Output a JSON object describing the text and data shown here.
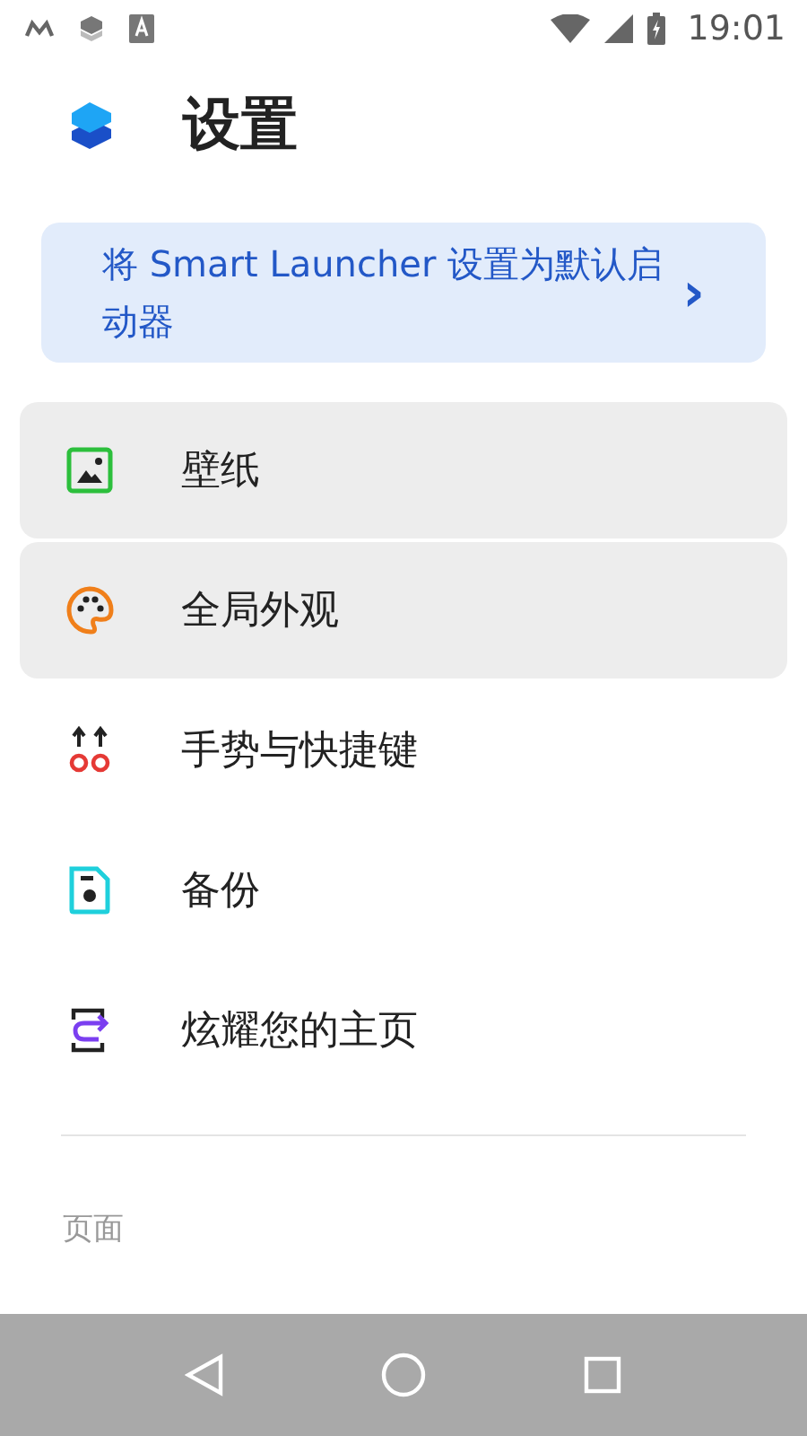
{
  "status_bar": {
    "time": "19:01"
  },
  "header": {
    "title": "设置"
  },
  "banner": {
    "text": "将 Smart Launcher 设置为默认启动器",
    "arrow": "›"
  },
  "items": [
    {
      "kind": "wallpaper",
      "label": "壁纸",
      "highlighted": true
    },
    {
      "kind": "palette",
      "label": "全局外观",
      "highlighted": true
    },
    {
      "kind": "gestures",
      "label": "手势与快捷键",
      "highlighted": false
    },
    {
      "kind": "backup",
      "label": "备份",
      "highlighted": false
    },
    {
      "kind": "share",
      "label": "炫耀您的主页",
      "highlighted": false
    }
  ],
  "section": {
    "title": "页面"
  }
}
